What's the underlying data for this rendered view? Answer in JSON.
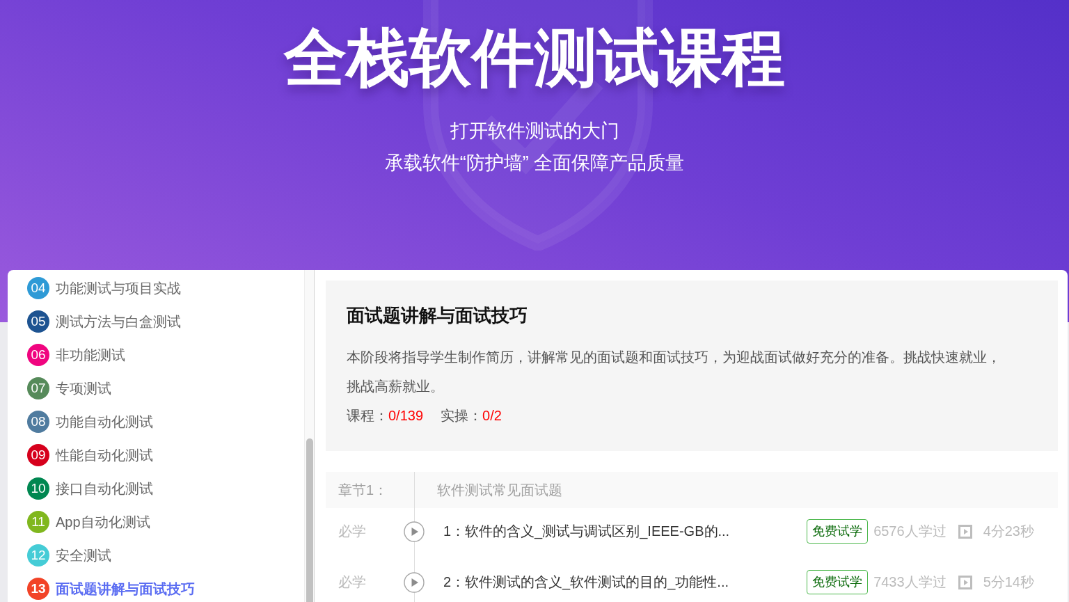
{
  "banner": {
    "title": "全栈软件测试课程",
    "subtitle_lines": [
      "打开软件测试的大门",
      "承载软件“防护墙” 全面保障产品质量"
    ]
  },
  "sidebar": {
    "items": [
      {
        "number": "04",
        "label": "功能测试与项目实战",
        "color": "#2e9ad6",
        "selected": false
      },
      {
        "number": "05",
        "label": "测试方法与白盒测试",
        "color": "#1d5391",
        "selected": false
      },
      {
        "number": "06",
        "label": "非功能测试",
        "color": "#f0047f",
        "selected": false
      },
      {
        "number": "07",
        "label": "专项测试",
        "color": "#568a5a",
        "selected": false
      },
      {
        "number": "08",
        "label": "功能自动化测试",
        "color": "#4f7b9f",
        "selected": false
      },
      {
        "number": "09",
        "label": "性能自动化测试",
        "color": "#d6001c",
        "selected": false
      },
      {
        "number": "10",
        "label": "接口自动化测试",
        "color": "#008751",
        "selected": false
      },
      {
        "number": "11",
        "label": "App自动化测试",
        "color": "#80b71e",
        "selected": false
      },
      {
        "number": "12",
        "label": "安全测试",
        "color": "#45ccd6",
        "selected": false
      },
      {
        "number": "13",
        "label": "面试题讲解与面试技巧",
        "color": "#f24327",
        "selected": true
      }
    ]
  },
  "stage": {
    "title": "面试题讲解与面试技巧",
    "description": "本阶段将指导学生制作简历，讲解常见的面试题和面试技巧，为迎战面试做好充分的准备。挑战快速就业，挑战高薪就业。",
    "stats": [
      {
        "label": "课程：",
        "value": "0/139"
      },
      {
        "label": "实操：",
        "value": "0/2"
      }
    ]
  },
  "chapters": [
    {
      "label": "章节1：",
      "title": "软件测试常见面试题",
      "lessons": [
        {
          "tag": "必学",
          "title": "1：软件的含义_测试与调试区别_IEEE-GB的...",
          "badge": "免费试学",
          "learners": "6576人学过",
          "duration": "4分23秒"
        },
        {
          "tag": "必学",
          "title": "2：软件测试的含义_软件测试的目的_功能性...",
          "badge": "免费试学",
          "learners": "7433人学过",
          "duration": "5分14秒"
        }
      ]
    }
  ]
}
